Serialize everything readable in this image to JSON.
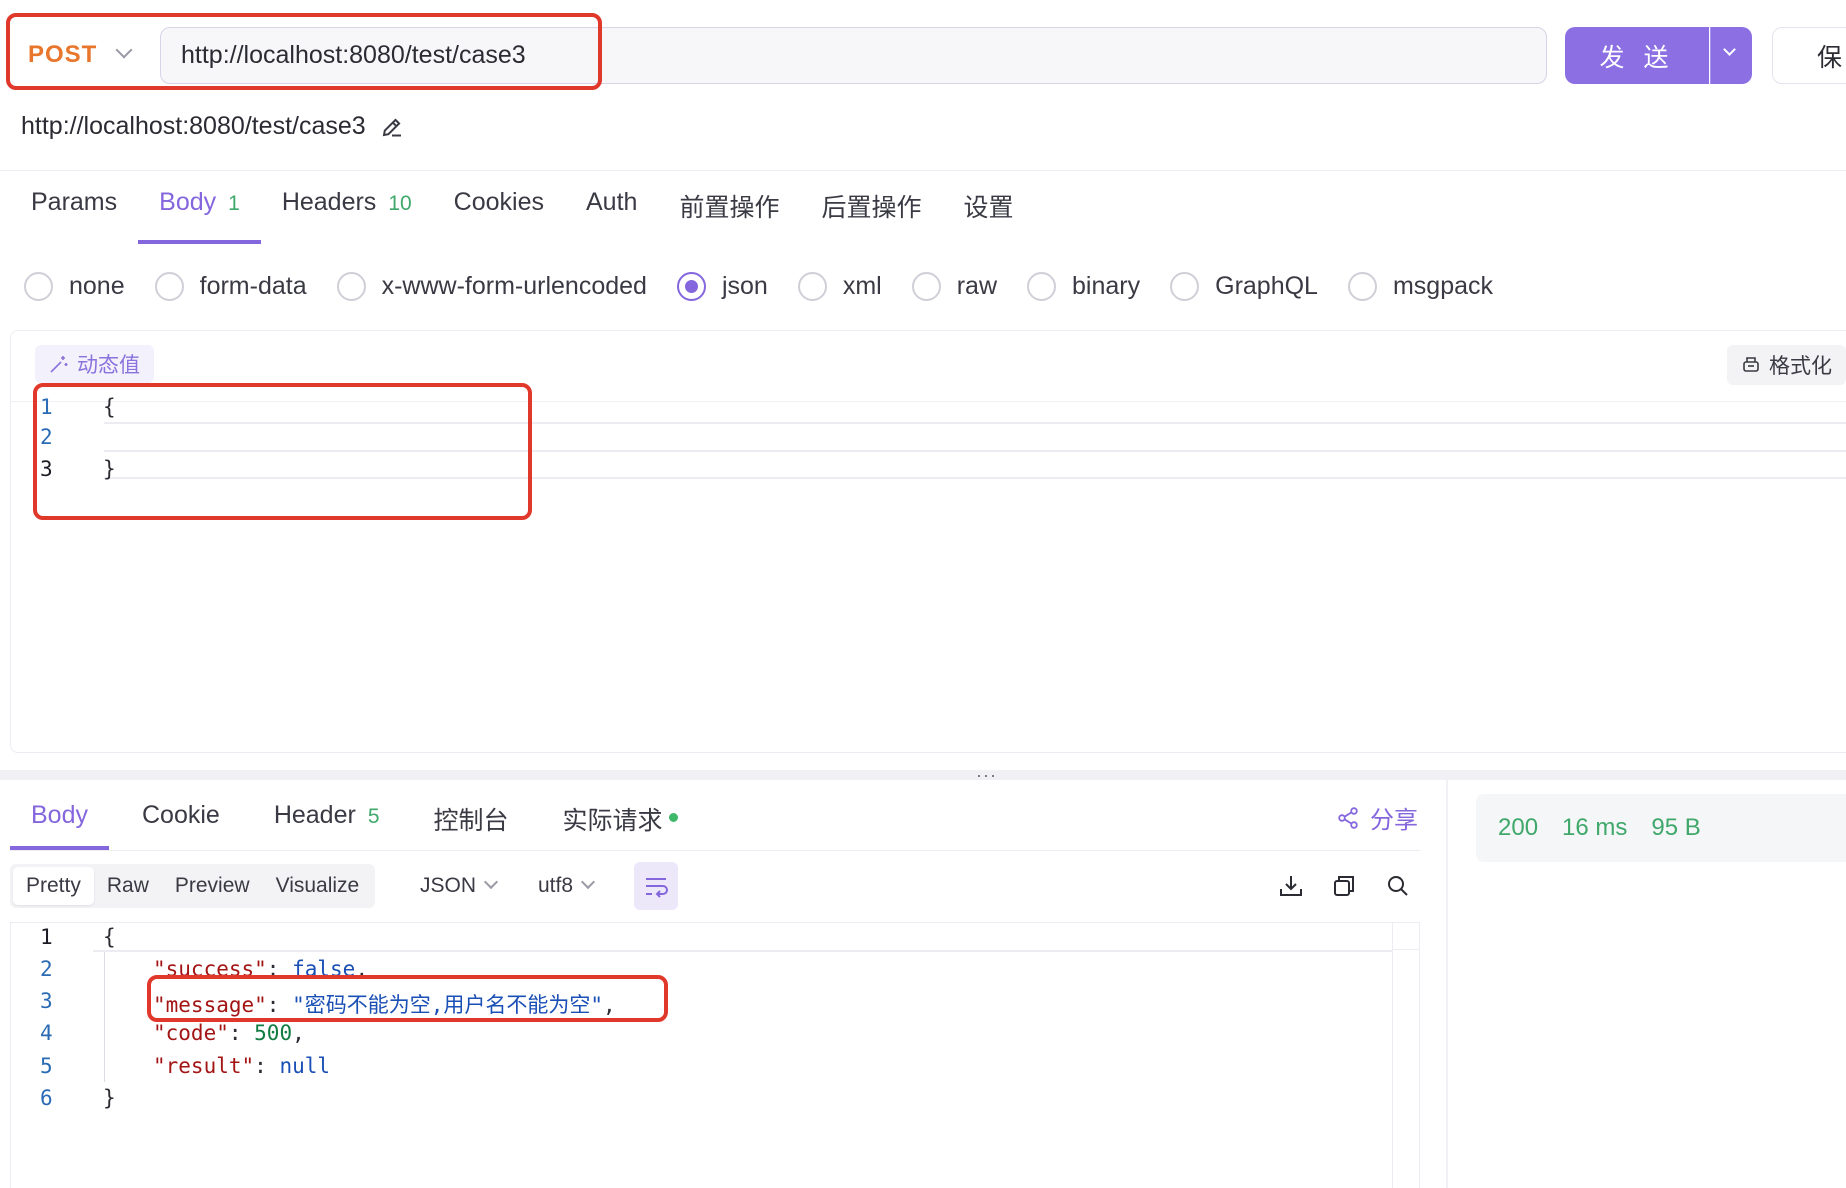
{
  "request": {
    "method": "POST",
    "url": "http://localhost:8080/test/case3",
    "resolved_url": "http://localhost:8080/test/case3",
    "send_label": "发 送",
    "save_label": "保"
  },
  "tabs": [
    {
      "label": "Params",
      "badge": ""
    },
    {
      "label": "Body",
      "badge": "1"
    },
    {
      "label": "Headers",
      "badge": "10"
    },
    {
      "label": "Cookies",
      "badge": ""
    },
    {
      "label": "Auth",
      "badge": ""
    },
    {
      "label": "前置操作",
      "badge": ""
    },
    {
      "label": "后置操作",
      "badge": ""
    },
    {
      "label": "设置",
      "badge": ""
    }
  ],
  "body_types": [
    "none",
    "form-data",
    "x-www-form-urlencoded",
    "json",
    "xml",
    "raw",
    "binary",
    "GraphQL",
    "msgpack"
  ],
  "selected_body_type": "json",
  "editor": {
    "dynamic_value_label": "动态值",
    "format_label": "格式化",
    "line_numbers": [
      "1",
      "2",
      "3"
    ],
    "lines": [
      "{",
      "",
      "}"
    ]
  },
  "response": {
    "tabs": [
      {
        "label": "Body",
        "badge": ""
      },
      {
        "label": "Cookie",
        "badge": ""
      },
      {
        "label": "Header",
        "badge": "5"
      },
      {
        "label": "控制台",
        "badge": ""
      },
      {
        "label": "实际请求",
        "badge": ""
      }
    ],
    "share_label": "分享",
    "view_modes": [
      "Pretty",
      "Raw",
      "Preview",
      "Visualize"
    ],
    "format_select": "JSON",
    "encoding_select": "utf8",
    "line_numbers": [
      "1",
      "2",
      "3",
      "4",
      "5",
      "6"
    ],
    "body": {
      "open": "{",
      "close": "}",
      "success_key": "\"success\"",
      "success_val": "false",
      "message_key": "\"message\"",
      "message_val": "\"密码不能为空,用户名不能为空\"",
      "code_key": "\"code\"",
      "code_val": "500",
      "result_key": "\"result\"",
      "result_val": "null"
    },
    "status_code": "200",
    "time": "16 ms",
    "size": "95 B"
  },
  "colors": {
    "accent": "#8466dd",
    "method": "#e8762c",
    "success": "#3fa86a",
    "highlight": "#e0392b"
  }
}
